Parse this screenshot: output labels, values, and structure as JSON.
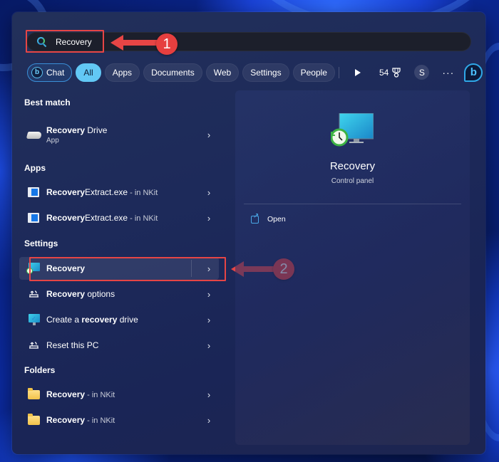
{
  "search": {
    "query": "Recovery",
    "placeholder": ""
  },
  "filters": {
    "chat_label": "Chat",
    "chips": [
      "All",
      "Apps",
      "Documents",
      "Web",
      "Settings",
      "People"
    ],
    "active": "All",
    "points": "54",
    "avatar_initial": "S",
    "more_label": "···",
    "bing_label": "b"
  },
  "annotations": {
    "step1": "1",
    "step2": "2",
    "color": "#e64545"
  },
  "results": {
    "best_match": {
      "title": "Best match",
      "items": [
        {
          "bold": "Recovery",
          "rest": " Drive",
          "sub": "App",
          "icon": "drive-icon"
        }
      ]
    },
    "apps": {
      "title": "Apps",
      "items": [
        {
          "bold": "Recovery",
          "rest": "Extract.exe",
          "loc": " - in NKit",
          "icon": "exe-icon"
        },
        {
          "bold": "Recovery",
          "rest": "Extract.exe",
          "loc": " - in NKit",
          "icon": "exe-icon"
        }
      ]
    },
    "settings": {
      "title": "Settings",
      "items": [
        {
          "pre": "",
          "bold": "Recovery",
          "rest": "",
          "icon": "recovery-monitor-icon",
          "selected": true
        },
        {
          "pre": "",
          "bold": "Recovery",
          "rest": " options",
          "icon": "reset-icon"
        },
        {
          "pre": "Create a ",
          "bold": "recovery",
          "rest": " drive",
          "icon": "recovery-drive-monitor-icon"
        },
        {
          "pre": "Reset this PC",
          "bold": "",
          "rest": "",
          "icon": "reset-icon"
        }
      ]
    },
    "folders": {
      "title": "Folders",
      "items": [
        {
          "bold": "Recovery",
          "loc": " - in NKit",
          "icon": "folder-icon"
        },
        {
          "bold": "Recovery",
          "loc": " - in NKit",
          "icon": "folder-icon"
        }
      ]
    }
  },
  "preview": {
    "title": "Recovery",
    "subtitle": "Control panel",
    "actions": [
      {
        "label": "Open",
        "icon": "open-external-icon"
      }
    ]
  },
  "colors": {
    "accent": "#62c8f5",
    "annotation_red": "#e64545",
    "folder_yellow": "#f2c24a"
  }
}
